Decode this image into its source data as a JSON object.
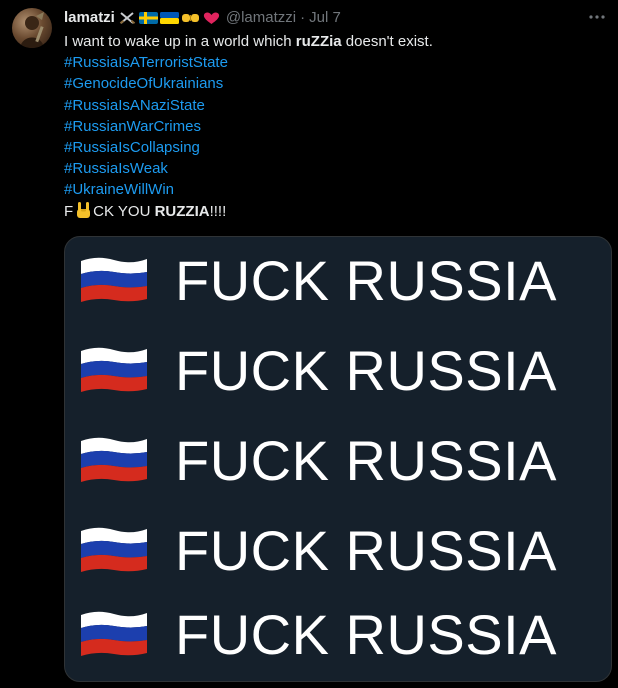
{
  "tweet": {
    "display_name": "lamatzi",
    "handle": "@lamatzzi",
    "separator": "·",
    "date": "Jul 7",
    "badges": [
      "crossed-swords-icon",
      "sweden-flag-icon",
      "ukraine-flag-icon",
      "fist-bump-icon",
      "red-heart-icon"
    ],
    "text": {
      "line1_prefix": "I want to wake up in a world which ",
      "line1_emph": "ruZZia",
      "line1_suffix": " doesn't exist.",
      "hashtags": [
        "#RussiaIsATerroristState",
        "#GenocideOfUkrainians",
        "#RussiaIsANaziState",
        "#RussianWarCrimes",
        "#RussiaIsCollapsing",
        "#RussiaIsWeak",
        "#UkraineWillWin"
      ],
      "last_prefix": "F",
      "last_icon": "sign-of-horns-icon",
      "last_middle": "CK YOU ",
      "last_emph": "RUZZIA",
      "last_suffix": "!!!!"
    },
    "media": {
      "rows": [
        {
          "flag": "russia-flag-icon",
          "caption": "FUCK RUSSIA"
        },
        {
          "flag": "russia-flag-icon",
          "caption": "FUCK RUSSIA"
        },
        {
          "flag": "russia-flag-icon",
          "caption": "FUCK RUSSIA"
        },
        {
          "flag": "russia-flag-icon",
          "caption": "FUCK RUSSIA"
        },
        {
          "flag": "russia-flag-icon",
          "caption": "FUCK RUSSIA"
        }
      ]
    },
    "more_icon": "more-options-icon",
    "colors": {
      "background": "#000000",
      "text": "#e7e9ea",
      "secondary": "#71767b",
      "link": "#1d9bf0",
      "media_background": "#15202b"
    }
  }
}
